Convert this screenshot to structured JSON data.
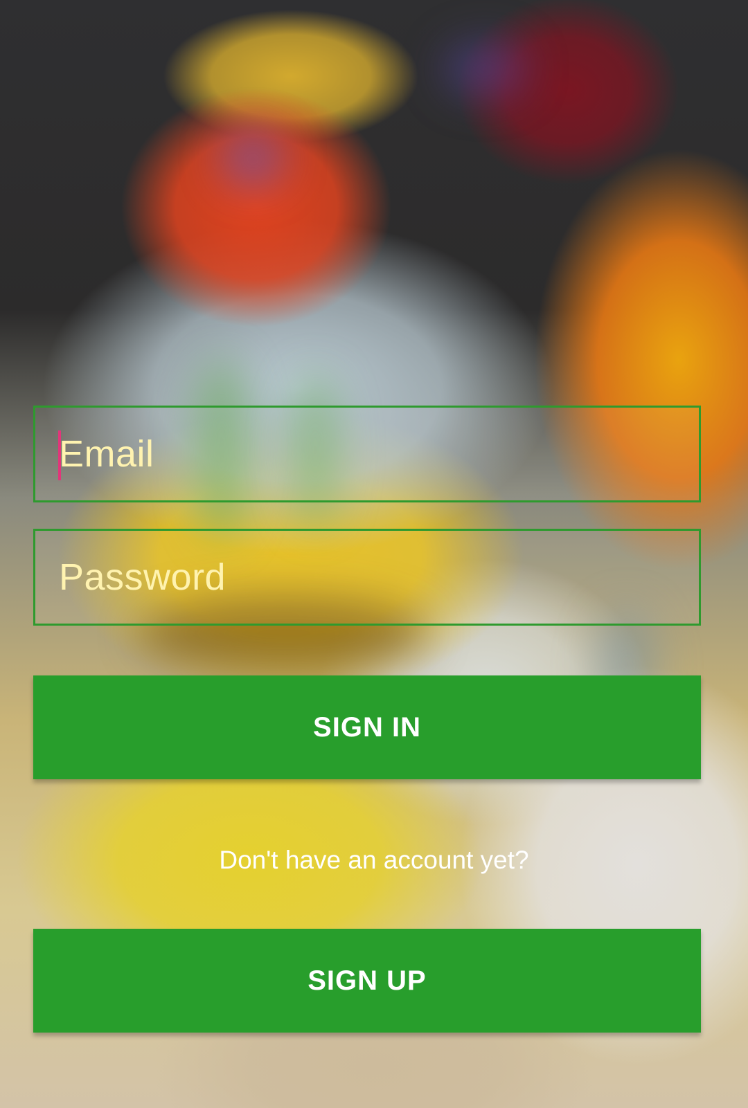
{
  "form": {
    "email_placeholder": "Email",
    "password_placeholder": "Password"
  },
  "actions": {
    "sign_in_label": "SIGN IN",
    "account_prompt": "Don't have an account yet?",
    "sign_up_label": "SIGN UP"
  },
  "colors": {
    "accent_green": "#289e2c",
    "field_border": "#2e9a2e",
    "placeholder_text": "#fff3b0",
    "caret": "#e2357a"
  }
}
